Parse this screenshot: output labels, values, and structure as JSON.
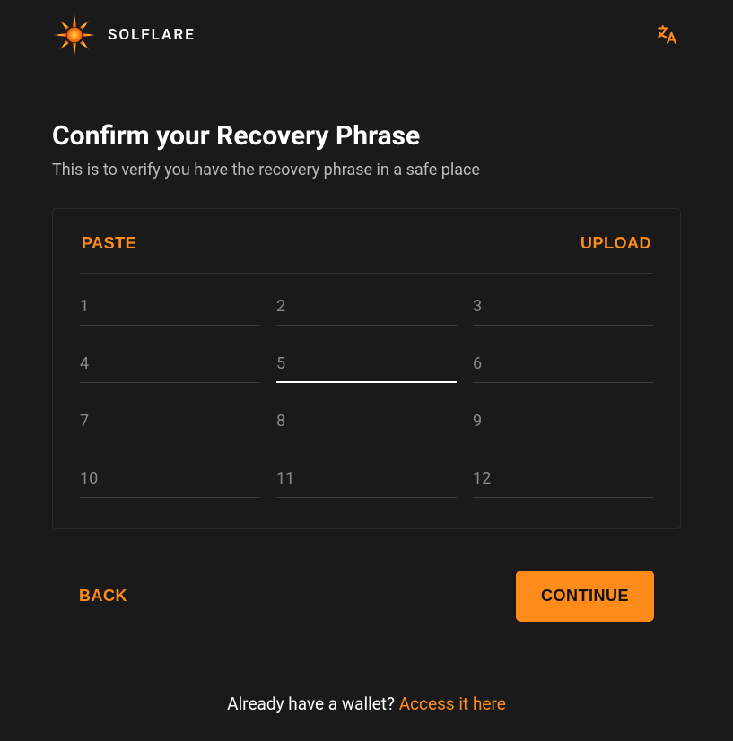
{
  "brand": {
    "name": "SOLFLARE"
  },
  "colors": {
    "accent": "#ff8c1a"
  },
  "page": {
    "title": "Confirm your Recovery Phrase",
    "subtitle": "This is to verify you have the recovery phrase in a safe place"
  },
  "actions": {
    "paste": "PASTE",
    "upload": "UPLOAD",
    "back": "BACK",
    "continue": "CONTINUE"
  },
  "phrase": {
    "count": 12,
    "focused_index": 5,
    "labels": [
      "1",
      "2",
      "3",
      "4",
      "5",
      "6",
      "7",
      "8",
      "9",
      "10",
      "11",
      "12"
    ],
    "values": [
      "",
      "",
      "",
      "",
      "",
      "",
      "",
      "",
      "",
      "",
      "",
      ""
    ]
  },
  "footer": {
    "prompt": "Already have a wallet? ",
    "link": "Access it here"
  }
}
